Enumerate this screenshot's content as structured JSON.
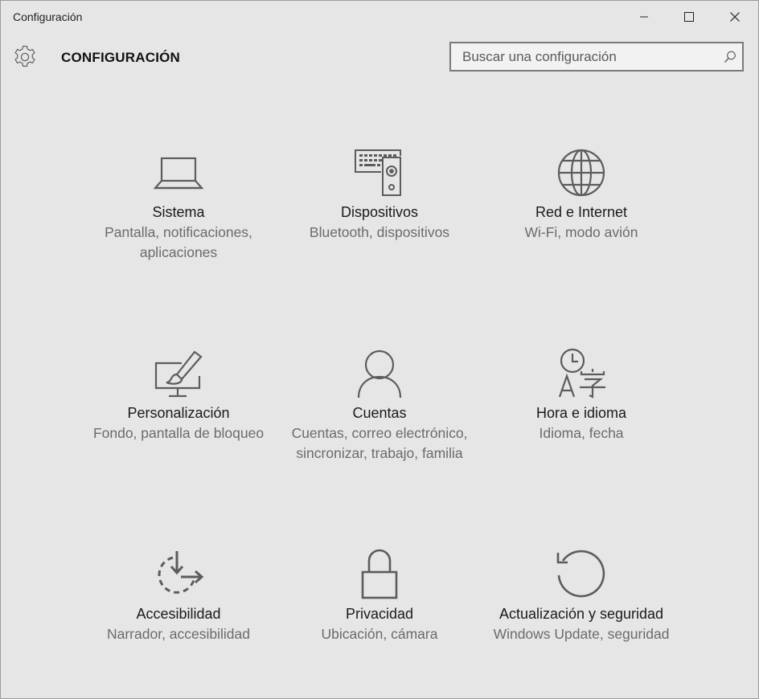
{
  "window": {
    "title": "Configuración"
  },
  "header": {
    "title": "CONFIGURACIÓN",
    "search_placeholder": "Buscar una configuración"
  },
  "tiles": [
    {
      "name": "Sistema",
      "desc": "Pantalla, notificaciones, aplicaciones",
      "icon": "laptop-icon"
    },
    {
      "name": "Dispositivos",
      "desc": "Bluetooth, dispositivos",
      "icon": "devices-icon"
    },
    {
      "name": "Red e Internet",
      "desc": "Wi-Fi, modo avión",
      "icon": "globe-icon"
    },
    {
      "name": "Personalización",
      "desc": "Fondo, pantalla de bloqueo",
      "icon": "personalization-icon"
    },
    {
      "name": "Cuentas",
      "desc": "Cuentas, correo electrónico, sincronizar, trabajo, familia",
      "icon": "person-icon"
    },
    {
      "name": "Hora e idioma",
      "desc": "Idioma, fecha",
      "icon": "time-language-icon"
    },
    {
      "name": "Accesibilidad",
      "desc": "Narrador, accesibilidad",
      "icon": "accessibility-icon"
    },
    {
      "name": "Privacidad",
      "desc": "Ubicación, cámara",
      "icon": "lock-icon"
    },
    {
      "name": "Actualización y seguridad",
      "desc": "Windows Update, seguridad",
      "icon": "update-icon"
    }
  ],
  "colors": {
    "background": "#e6e6e6",
    "icon": "#5c5c5c",
    "description": "#6b6b6b"
  }
}
